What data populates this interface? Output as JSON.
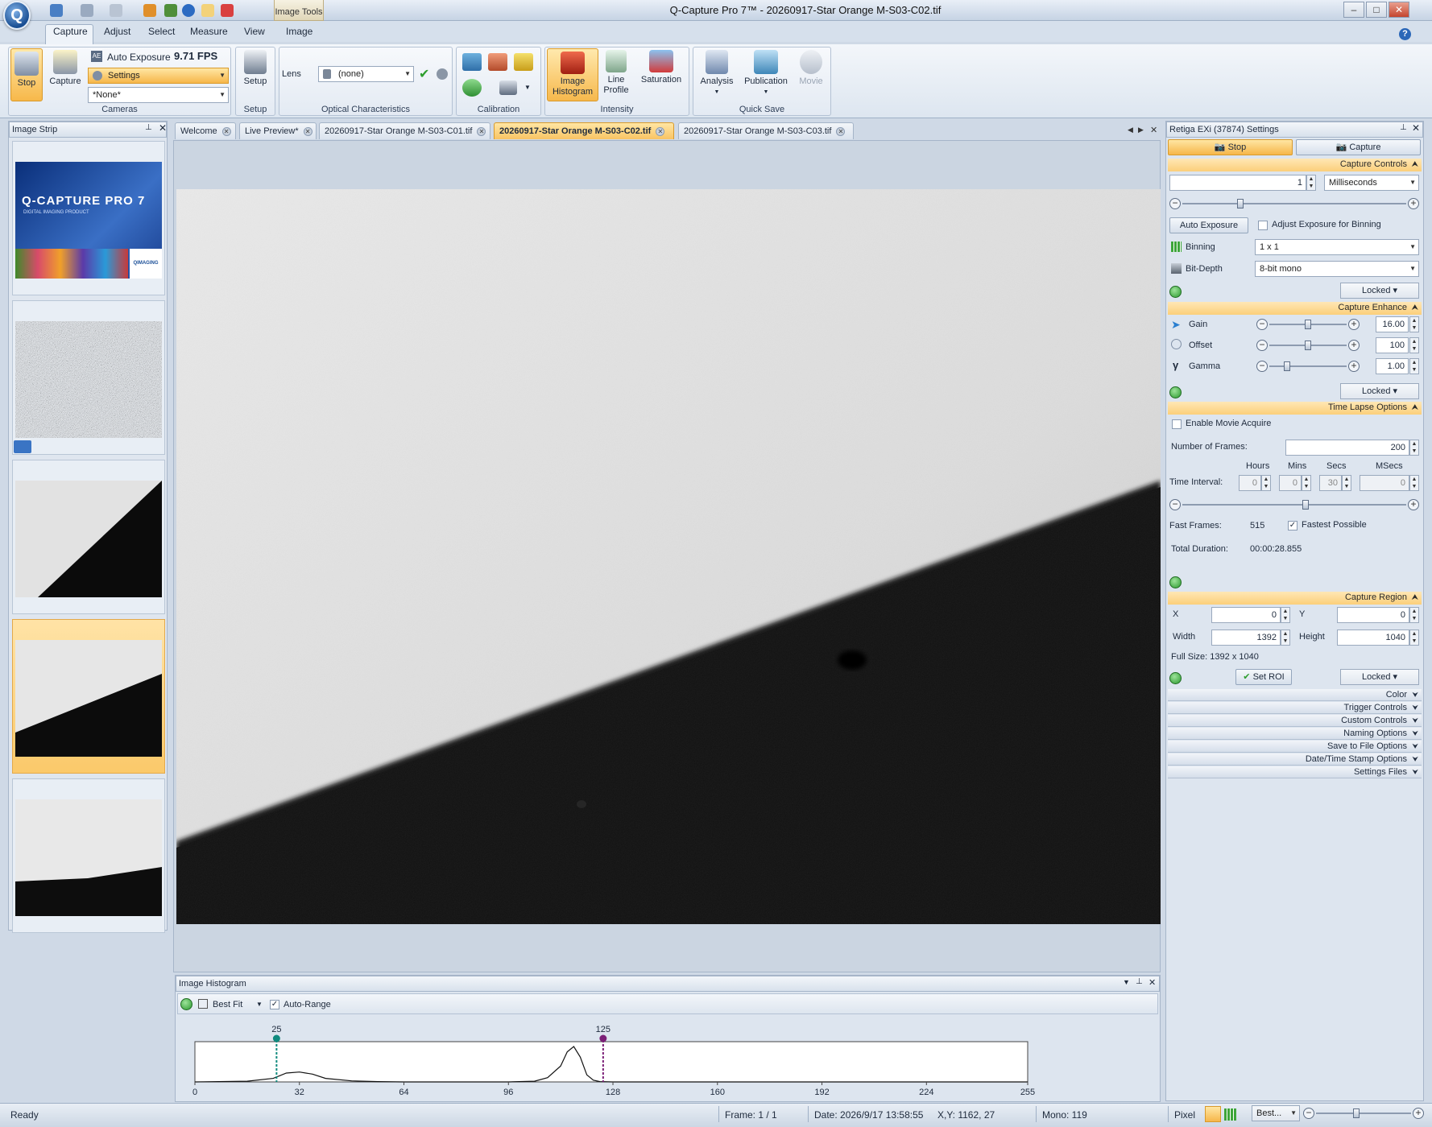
{
  "window": {
    "title": "Q-Capture Pro 7™ - 20260917-Star Orange M-S03-C02.tif",
    "context_tab": "Image Tools"
  },
  "ribbon_tabs": [
    "Capture",
    "Adjust",
    "Select",
    "Measure",
    "View",
    "Image"
  ],
  "ribbon": {
    "cameras": {
      "stop": "Stop",
      "capture": "Capture",
      "auto_exposure": "Auto Exposure",
      "fps": "9.71 FPS",
      "settings": "Settings",
      "preset": "*None*",
      "group": "Cameras"
    },
    "setup": {
      "button": "Setup",
      "group": "Setup"
    },
    "optical": {
      "lens_label": "Lens",
      "lens_value": "(none)",
      "group": "Optical Characteristics"
    },
    "calibration": {
      "group": "Calibration"
    },
    "intensity": {
      "image_histogram": "Image Histogram",
      "line_profile": "Line Profile",
      "saturation": "Saturation",
      "group": "Intensity"
    },
    "quick_save": {
      "analysis": "Analysis",
      "publication": "Publication",
      "movie": "Movie",
      "group": "Quick Save"
    }
  },
  "image_strip": {
    "title": "Image Strip",
    "splash_title": "Q-CAPTURE PRO 7",
    "splash_subtitle": "DIGITAL IMAGING PRODUCT",
    "splash_brand": "QIMAGING"
  },
  "doc_tabs": [
    "Welcome",
    "Live Preview*",
    "20260917-Star Orange M-S03-C01.tif",
    "20260917-Star Orange M-S03-C02.tif",
    "20260917-Star Orange M-S03-C03.tif"
  ],
  "active_doc_tab": 3,
  "histogram": {
    "title": "Image Histogram",
    "fit": "Best Fit",
    "auto_range": "Auto-Range",
    "low_marker": "25",
    "high_marker": "125",
    "ticks": [
      "0",
      "32",
      "64",
      "96",
      "128",
      "160",
      "192",
      "224",
      "255"
    ],
    "chart_data": {
      "type": "area",
      "x_range": [
        0,
        255
      ],
      "x_ticks": [
        0,
        32,
        64,
        96,
        128,
        160,
        192,
        224,
        255
      ],
      "markers": [
        25,
        125
      ],
      "x": [
        0,
        16,
        24,
        28,
        32,
        36,
        40,
        48,
        56,
        64,
        96,
        104,
        108,
        112,
        114,
        116,
        118,
        120,
        122,
        124,
        128,
        160,
        255
      ],
      "y": [
        0,
        0.02,
        0.1,
        0.25,
        0.28,
        0.22,
        0.1,
        0.03,
        0.01,
        0,
        0,
        0.02,
        0.12,
        0.45,
        0.85,
        1.0,
        0.7,
        0.2,
        0.05,
        0.01,
        0,
        0,
        0
      ]
    }
  },
  "settings": {
    "title": "Retiga EXi (37874) Settings",
    "stop": "Stop",
    "capture": "Capture",
    "capture_controls": {
      "header": "Capture Controls",
      "exposure": "1",
      "unit": "Milliseconds",
      "exposure_slider": 0.25,
      "auto_exposure": "Auto Exposure",
      "adjust_binning": "Adjust Exposure for Binning",
      "binning_label": "Binning",
      "binning": "1 x 1",
      "bitdepth_label": "Bit-Depth",
      "bitdepth": "8-bit mono",
      "locked": "Locked"
    },
    "capture_enhance": {
      "header": "Capture Enhance",
      "gain_label": "Gain",
      "gain": "16.00",
      "gain_slider": 0.5,
      "offset_label": "Offset",
      "offset": "100",
      "offset_slider": 0.5,
      "gamma_label": "Gamma",
      "gamma": "1.00",
      "gamma_slider": 0.2,
      "locked": "Locked"
    },
    "time_lapse": {
      "header": "Time Lapse Options",
      "enable_movie": "Enable Movie Acquire",
      "frames_label": "Number of Frames:",
      "frames": "200",
      "hours": "Hours",
      "mins": "Mins",
      "secs": "Secs",
      "msecs": "MSecs",
      "interval_label": "Time Interval:",
      "h": "0",
      "m": "0",
      "s": "30",
      "ms": "0",
      "interval_slider": 0.55,
      "fast_frames_label": "Fast Frames:",
      "fast_frames": "515",
      "fastest": "Fastest Possible",
      "total_label": "Total Duration:",
      "total": "00:00:28.855"
    },
    "capture_region": {
      "header": "Capture Region",
      "x_label": "X",
      "x": "0",
      "y_label": "Y",
      "y": "0",
      "width_label": "Width",
      "width": "1392",
      "height_label": "Height",
      "height": "1040",
      "full_size": "Full Size: 1392 x 1040",
      "set_roi": "Set ROI",
      "locked": "Locked"
    },
    "collapsed": [
      "Color",
      "Trigger Controls",
      "Custom Controls",
      "Naming Options",
      "Save to File Options",
      "Date/Time Stamp Options",
      "Settings Files"
    ]
  },
  "status": {
    "ready": "Ready",
    "frame": "Frame: 1 / 1",
    "date": "Date: 2026/9/17 13:58:55",
    "xy": "X,Y: 1162,   27",
    "mono": "Mono:   119",
    "pixel": "Pixel",
    "zoom": "Best..."
  },
  "colors": {
    "accent": "#f7b84a",
    "teal_marker": "#0f8a7e",
    "purple_marker": "#7b1f77"
  }
}
